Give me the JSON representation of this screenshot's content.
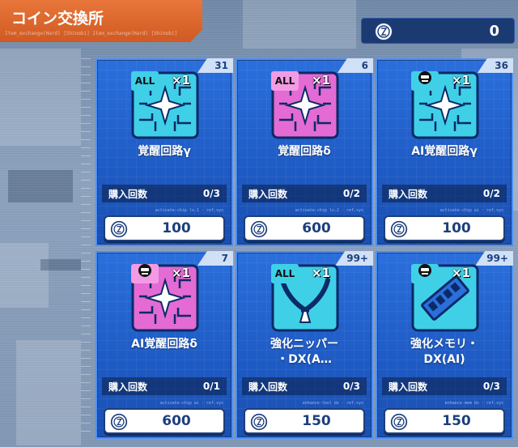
{
  "header": {
    "title": "コイン交換所",
    "subtitle": "Item_exchange(Hard) [Shinobi] Item_exchange(Hard) [Shinobi]",
    "coin_count": "0"
  },
  "colors": {
    "card_blue": "#2a6fdc",
    "chip_cyan": "#3fd0e8",
    "chip_pink": "#e46bd4",
    "tag_cyan": "#3fd0e8",
    "tag_pink": "#f29be4",
    "title_orange": "#e06a2c"
  },
  "labels": {
    "purchase_count": "購入回数"
  },
  "cards": [
    {
      "stock": "31",
      "tag": "ALL",
      "tag_color": "cyan",
      "qty": "×1",
      "icon": "chip-icon",
      "chip_color": "cyan",
      "name": "覚醒回路γ",
      "purchases": "0/3",
      "price": "100",
      "meta": "activate-chip lv.1 · ref.sys"
    },
    {
      "stock": "6",
      "tag": "ALL",
      "tag_color": "pink",
      "qty": "×1",
      "icon": "chip-icon",
      "chip_color": "pink",
      "name": "覚醒回路δ",
      "purchases": "0/2",
      "price": "600",
      "meta": "activate-chip lv.2 · ref.sys"
    },
    {
      "stock": "36",
      "tag": "AI",
      "tag_color": "cyan",
      "qty": "×1",
      "icon": "chip-icon",
      "chip_color": "cyan",
      "name": "AI覚醒回路γ",
      "purchases": "0/2",
      "price": "100",
      "meta": "activate-chip ai · ref.sys"
    },
    {
      "stock": "7",
      "tag": "AI",
      "tag_color": "pink",
      "qty": "×1",
      "icon": "chip-icon",
      "chip_color": "pink",
      "name": "AI覚醒回路δ",
      "purchases": "0/1",
      "price": "600",
      "meta": "activate-chip ai · ref.sys"
    },
    {
      "stock": "99+",
      "tag": "ALL",
      "tag_color": "cyan",
      "qty": "×1",
      "icon": "nipper-icon",
      "chip_color": "cyan",
      "name": "強化ニッパー\n・DX(A…",
      "purchases": "0/3",
      "price": "150",
      "meta": "enhance-tool dx · ref.sys"
    },
    {
      "stock": "99+",
      "tag": "AI",
      "tag_color": "cyan",
      "qty": "×1",
      "icon": "memory-icon",
      "chip_color": "cyan",
      "name": "強化メモリ・\nDX(AI)",
      "purchases": "0/3",
      "price": "150",
      "meta": "enhance-mem dx · ref.sys"
    }
  ]
}
